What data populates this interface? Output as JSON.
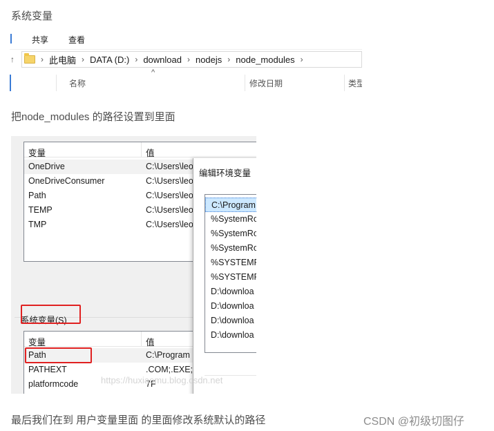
{
  "heading_system_vars": "系统变量",
  "explorer": {
    "ribbon": [
      "共享",
      "查看"
    ],
    "breadcrumb": [
      "此电脑",
      "DATA (D:)",
      "download",
      "nodejs",
      "node_modules"
    ],
    "columns": [
      "名称",
      "修改日期",
      "类型"
    ]
  },
  "para_set_path": "把node_modules 的路径设置到里面",
  "dialog": {
    "user_vars": {
      "col_var": "变量",
      "col_val": "值",
      "rows": [
        {
          "name": "OneDrive",
          "value": "C:\\Users\\leo"
        },
        {
          "name": "OneDriveConsumer",
          "value": "C:\\Users\\leo"
        },
        {
          "name": "Path",
          "value": "C:\\Users\\leo"
        },
        {
          "name": "TEMP",
          "value": "C:\\Users\\leo"
        },
        {
          "name": "TMP",
          "value": "C:\\Users\\leo"
        }
      ]
    },
    "system_vars_label": "系统变量(S)",
    "system_vars": {
      "col_var": "变量",
      "col_val": "值",
      "rows": [
        {
          "name": "Path",
          "value": "C:\\Program"
        },
        {
          "name": "PATHEXT",
          "value": ".COM;.EXE;."
        },
        {
          "name": "platformcode",
          "value": "7F"
        }
      ]
    },
    "edit_env": {
      "title": "编辑环境变量",
      "items": [
        "C:\\Program",
        "%SystemRo",
        "%SystemRo",
        "%SystemRo",
        "%SYSTEMR",
        "%SYSTEMR",
        "D:\\downloa",
        "D:\\downloa",
        "D:\\downloa",
        "D:\\downloa"
      ]
    }
  },
  "watermark": "https://huxiaomu.blog.csdn.net",
  "para_final": "最后我们在到 用户变量里面 的里面修改系统默认的路径",
  "csdn_badge": "CSDN @初级切图仔",
  "colors": {
    "highlight_box": "#e02020",
    "selected_item": "#cce8ff"
  }
}
